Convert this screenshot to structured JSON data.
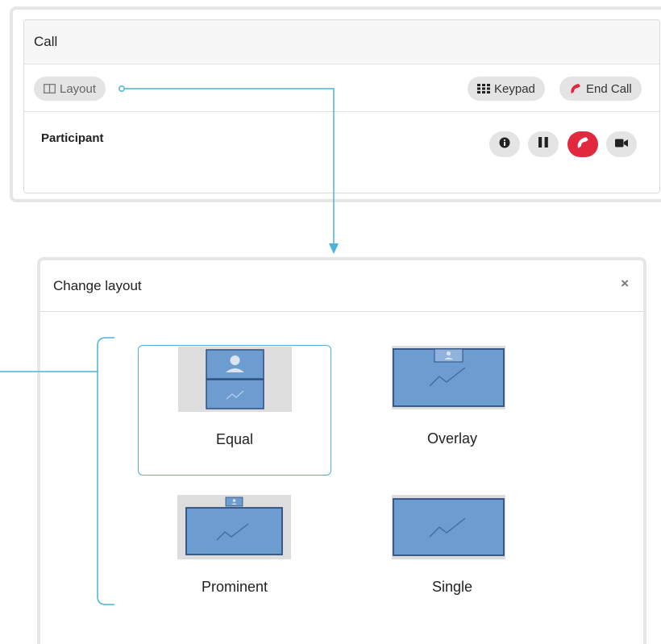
{
  "call_panel": {
    "title": "Call",
    "toolbar": {
      "layout_label": "Layout",
      "keypad_label": "Keypad",
      "end_call_label": "End Call"
    },
    "participant_label": "Participant",
    "participant_actions": [
      "info-icon",
      "pause-icon",
      "hangup-icon",
      "video-icon"
    ]
  },
  "dialog": {
    "title": "Change layout",
    "close_symbol": "×",
    "options": [
      {
        "label": "Equal",
        "selected": true
      },
      {
        "label": "Overlay",
        "selected": false
      },
      {
        "label": "Prominent",
        "selected": false
      },
      {
        "label": "Single",
        "selected": false
      }
    ]
  },
  "colors": {
    "accent_line": "#4cb3d9",
    "end_call_red": "#e2283f",
    "thumb_blue": "#6d9dd0",
    "thumb_border": "#2e4f80",
    "thumb_grey": "#dddddd"
  }
}
